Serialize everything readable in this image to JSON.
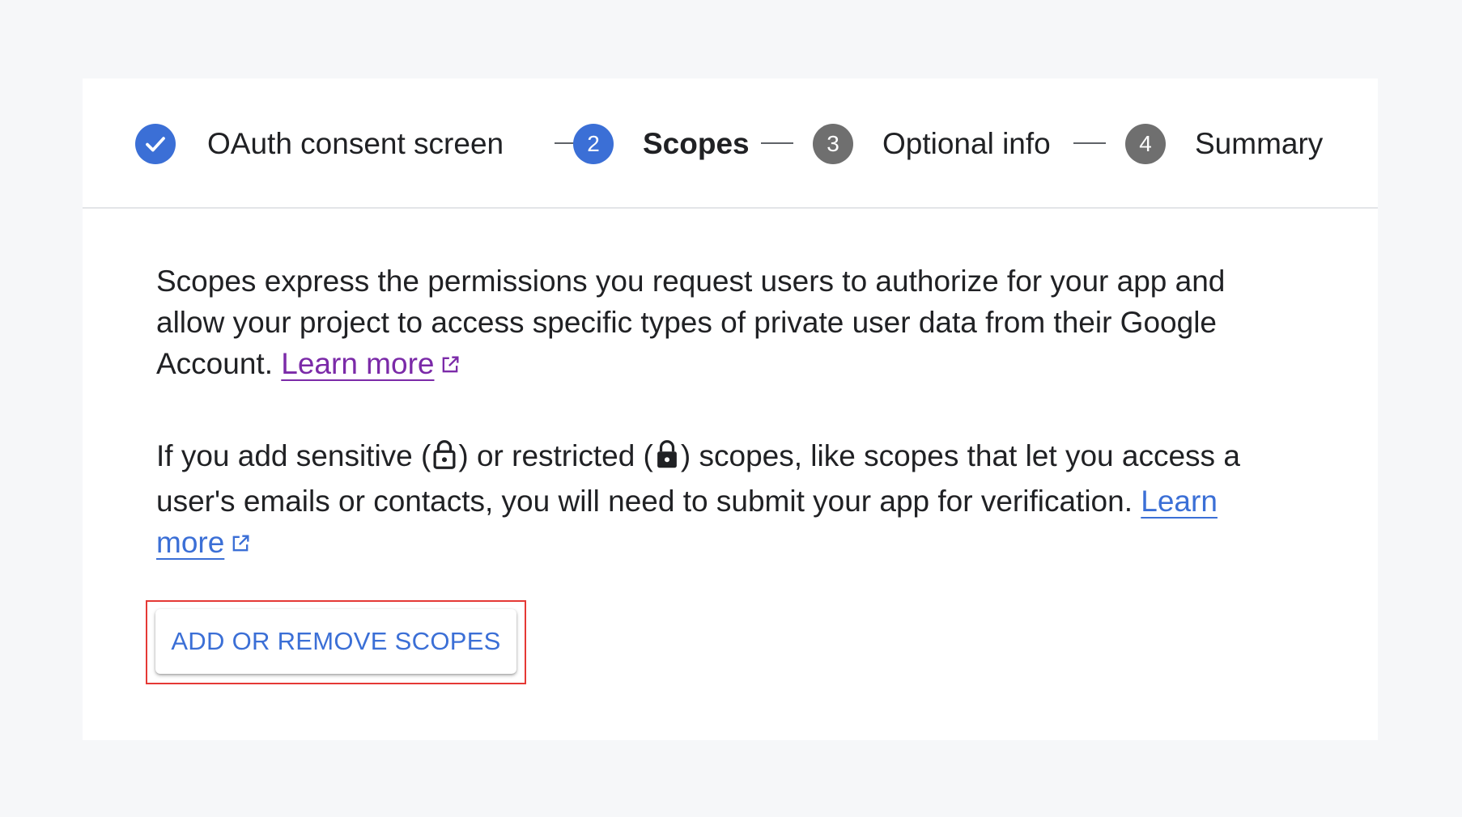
{
  "stepper": {
    "steps": [
      {
        "number": "",
        "label": "OAuth consent screen",
        "state": "completed",
        "icon": "check-icon"
      },
      {
        "number": "2",
        "label": "Scopes",
        "state": "current"
      },
      {
        "number": "3",
        "label": "Optional info",
        "state": "pending"
      },
      {
        "number": "4",
        "label": "Summary",
        "state": "pending"
      }
    ]
  },
  "content": {
    "paragraph1_text": "Scopes express the permissions you request users to authorize for your app and allow your project to access specific types of private user data from their Google Account.",
    "paragraph1_link": "Learn more",
    "paragraph2_part1": "If you add sensitive (",
    "paragraph2_part2": ") or restricted (",
    "paragraph2_part3": ") scopes, like scopes that let you access a user's emails or contacts, you will need to submit your app for verification.",
    "paragraph2_link": "Learn more"
  },
  "actions": {
    "add_remove_scopes_label": "ADD OR REMOVE SCOPES"
  },
  "colors": {
    "accent": "#3b6fd6",
    "visited_link": "#7b2aa8",
    "pending_step": "#6f6f6f",
    "highlight": "#e53935"
  }
}
